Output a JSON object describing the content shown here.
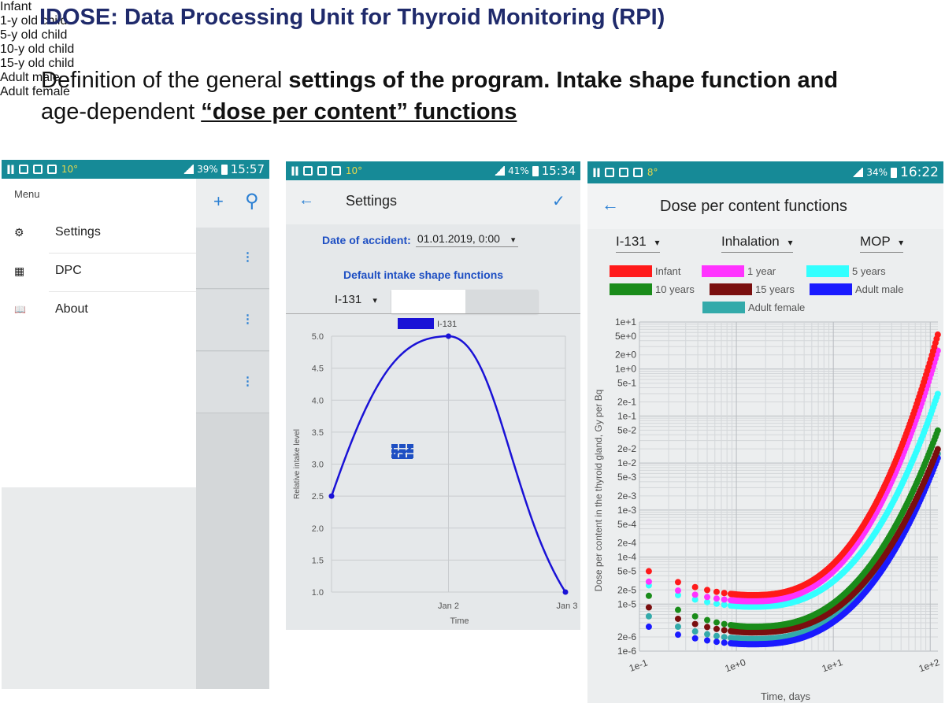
{
  "slide": {
    "title": "IDOSE: Data Processing Unit for Thyroid Monitoring (RPI)",
    "subtitle_part1": "Definition of the general ",
    "subtitle_bold1": "settings of the program. Intake shape function and",
    "subtitle_part2": " age-dependent ",
    "subtitle_underlined": "“dose per content” functions"
  },
  "phone1": {
    "status": {
      "temp": "10°",
      "battery": "39%",
      "time": "15:57"
    },
    "menu_header": "Menu",
    "menu_items": [
      {
        "icon": "gear-icon",
        "glyph": "⚙",
        "label": "Settings"
      },
      {
        "icon": "grid-icon",
        "glyph": "▦",
        "label": "DPC"
      },
      {
        "icon": "book-icon",
        "glyph": "📖",
        "label": "About"
      }
    ],
    "toolbar": {
      "add": "+",
      "search": "⚲"
    },
    "kebab": "⋮",
    "age_groups": [
      "Infant",
      "1-y old child",
      "5-y old child",
      "10-y old child",
      "15-y old child",
      "Adult male",
      "Adult female"
    ]
  },
  "phone2": {
    "status": {
      "temp": "10°",
      "battery": "41%",
      "time": "15:34"
    },
    "title": "Settings",
    "back": "←",
    "confirm": "✓",
    "date_label": "Date of accident:",
    "date_value": "01.01.2019, 0:00",
    "intake_heading": "Default intake shape functions",
    "isotope": "I-131",
    "dropdown_arrow": "▾",
    "chart_data": {
      "type": "line",
      "legend": [
        "I-131"
      ],
      "ylabel": "Relative intake level",
      "xlabel": "Time",
      "xtick_labels": [
        "Jan 2",
        "Jan 3"
      ],
      "ytick_labels": [
        "1.0",
        "1.5",
        "2.0",
        "2.5",
        "3.0",
        "3.5",
        "4.0",
        "4.5",
        "5.0"
      ],
      "ylim": [
        1.0,
        5.0
      ],
      "xlim": [
        0,
        2
      ],
      "series": [
        {
          "name": "I-131",
          "color": "#1a12d6",
          "x": [
            0,
            1,
            2
          ],
          "y": [
            2.5,
            5.0,
            1.0
          ]
        }
      ],
      "grid": true
    }
  },
  "phone3": {
    "status": {
      "temp": "8°",
      "battery": "34%",
      "time": "16:22"
    },
    "title": "Dose per content functions",
    "back": "←",
    "dropdowns": [
      "I-131",
      "Inhalation",
      "MOP"
    ],
    "chart_data": {
      "type": "scatter",
      "xlabel": "Time, days",
      "ylabel": "Dose per content in the thyroid gland, Gy per Bq",
      "x_scale": "log",
      "y_scale": "log",
      "xlim": [
        0.1,
        120
      ],
      "ylim": [
        1e-06,
        10
      ],
      "xtick_labels": [
        "1e-1",
        "1e+0",
        "1e+1",
        "1e+2"
      ],
      "ytick_labels": [
        "1e+1",
        "5e+0",
        "2e+0",
        "1e+0",
        "5e-1",
        "2e-1",
        "1e-1",
        "5e-2",
        "2e-2",
        "1e-2",
        "5e-3",
        "2e-3",
        "1e-3",
        "5e-4",
        "2e-4",
        "1e-4",
        "5e-5",
        "2e-5",
        "1e-5",
        "2e-6",
        "1e-6"
      ],
      "grid": true,
      "series": [
        {
          "name": "Infant",
          "color": "#ff1a1a",
          "y_min": 1.55e-05,
          "y_start": 5e-05,
          "y_end": 5.5
        },
        {
          "name": "1 year",
          "color": "#ff33ff",
          "y_min": 1.15e-05,
          "y_start": 3e-05,
          "y_end": 2.5
        },
        {
          "name": "5 years",
          "color": "#33ffff",
          "y_min": 8.8e-06,
          "y_start": 2.5e-05,
          "y_end": 0.3
        },
        {
          "name": "10 years",
          "color": "#1a8c1a",
          "y_min": 3.3e-06,
          "y_start": 1.5e-05,
          "y_end": 0.05
        },
        {
          "name": "15 years",
          "color": "#7a0f0f",
          "y_min": 2.5e-06,
          "y_start": 8.5e-06,
          "y_end": 0.02
        },
        {
          "name": "Adult male",
          "color": "#1a1aff",
          "y_min": 1.4e-06,
          "y_start": 3.3e-06,
          "y_end": 0.013
        },
        {
          "name": "Adult female",
          "color": "#33aaaa",
          "y_min": 1.8e-06,
          "y_start": 5.5e-06,
          "y_end": 0.016
        }
      ]
    }
  }
}
